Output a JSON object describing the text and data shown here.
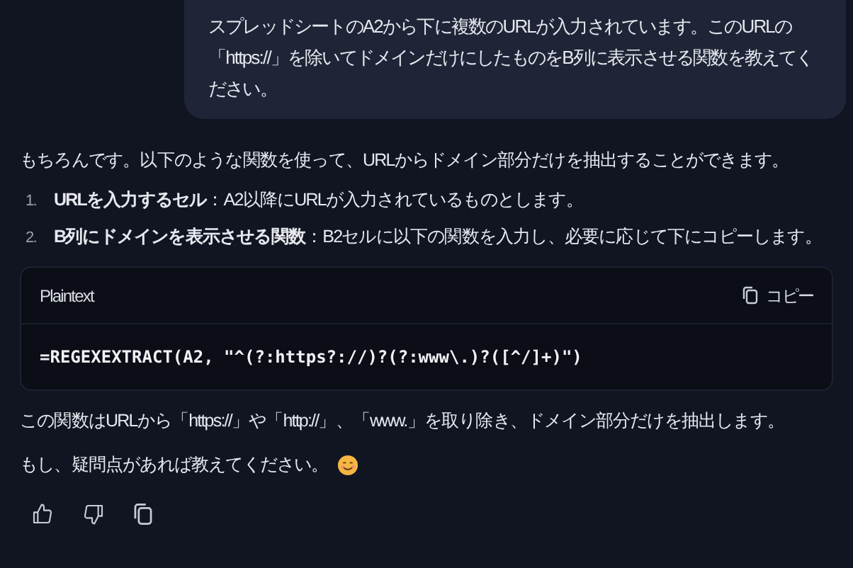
{
  "user_message": {
    "text": "スプレッドシートのA2から下に複数のURLが入力されています。このURLの「https://」を除いてドメインだけにしたものをB列に表示させる関数を教えてください。"
  },
  "response": {
    "intro": "もちろんです。以下のような関数を使って、URLからドメイン部分だけを抽出することができます。",
    "steps": [
      {
        "number": "1.",
        "text": "**URLを入力するセル**：A2以降にURLが入力されているものとします。"
      },
      {
        "number": "2.",
        "text": "**B列にドメインを表示させる関数**：B2セルに以下の関数を入力し、必要に応じて下にコピーします。"
      }
    ],
    "code_block": {
      "language": "Plaintext",
      "copy_label": "コピー",
      "code": "=REGEXEXTRACT(A2, \"^(?:https?://)?(?:www\\.)?([^/]+)\")"
    },
    "explanation": "この関数はURLから「https://」や「http://」、「www.」を取り除き、ドメイン部分だけを抽出します。",
    "closing": "もし、疑問点があれば教えてください。"
  }
}
